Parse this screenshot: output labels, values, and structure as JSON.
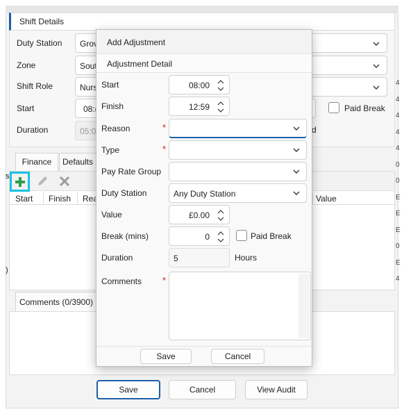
{
  "background": {
    "group_title": "Shift Details",
    "duty_station": {
      "label": "Duty Station",
      "value": "Grov"
    },
    "zone": {
      "label": "Zone",
      "value": "Sout"
    },
    "shift_role": {
      "label": "Shift Role",
      "value": "Nurs"
    },
    "start": {
      "label": "Start",
      "value": "08:("
    },
    "duration": {
      "label": "Duration",
      "value": "05:0",
      "suffix": "d"
    },
    "paid_break_label": "Paid Break",
    "tabs": [
      "Finance",
      "Defaults"
    ],
    "toolbar": {
      "add": "add",
      "edit": "edit",
      "delete": "delete"
    },
    "grid_columns": [
      "Start",
      "Finish",
      "Rea"
    ],
    "grid_right_column": "Value",
    "comments_tab": "Comments (0/3900)",
    "buttons": {
      "save": "Save",
      "cancel": "Cancel",
      "view_audit": "View Audit"
    },
    "right_edge_chars": [
      "4",
      "4",
      "4",
      "4",
      "4",
      "0",
      "0",
      "E",
      "E",
      "E",
      "0",
      "E",
      "4"
    ]
  },
  "modal": {
    "title": "Add Adjustment",
    "section": "Adjustment Detail",
    "fields": {
      "start": {
        "label": "Start",
        "value": "08:00"
      },
      "finish": {
        "label": "Finish",
        "value": "12:59"
      },
      "reason": {
        "label": "Reason",
        "value": ""
      },
      "type": {
        "label": "Type",
        "value": ""
      },
      "pay_rate_group": {
        "label": "Pay Rate Group",
        "value": ""
      },
      "duty_station": {
        "label": "Duty Station",
        "value": "Any Duty Station"
      },
      "value": {
        "label": "Value",
        "value": "£0.00"
      },
      "break_mins": {
        "label": "Break (mins)",
        "value": "0"
      },
      "paid_break": {
        "label": "Paid Break",
        "checked": false
      },
      "duration": {
        "label": "Duration",
        "value": "5",
        "unit": "Hours"
      },
      "comments": {
        "label": "Comments",
        "value": ""
      }
    },
    "required_marker": "*",
    "buttons": {
      "save": "Save",
      "cancel": "Cancel"
    }
  },
  "colors": {
    "accent": "#1d5fa6",
    "add_green": "#2e9e4a",
    "highlight": "#19c3e6",
    "required": "#d02020"
  }
}
